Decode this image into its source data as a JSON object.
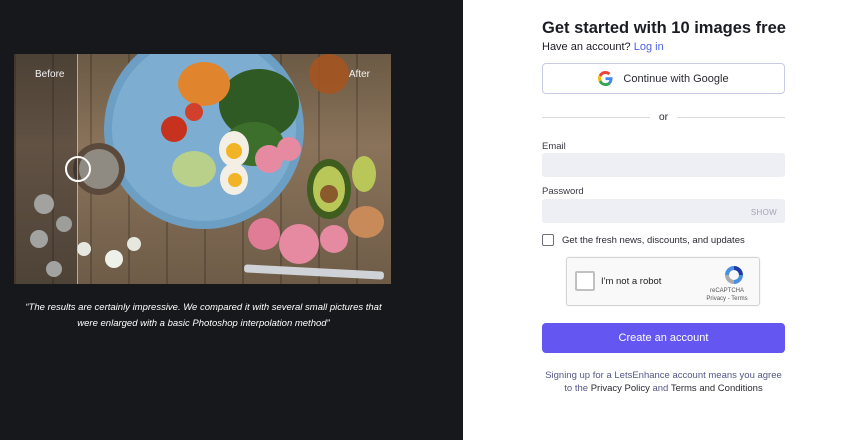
{
  "left": {
    "before_label": "Before",
    "after_label": "After",
    "testimonial": "“The results are certainly impressive. We compared it with several small pictures that were enlarged with a basic Photoshop interpolation method”"
  },
  "form": {
    "title": "Get started with 10 images free",
    "have_account": "Have an account?",
    "login_link": "Log in",
    "google_button": "Continue with Google",
    "or_text": "or",
    "email_label": "Email",
    "email_value": "",
    "password_label": "Password",
    "password_value": "",
    "show_label": "SHOW",
    "newsletter_label": "Get the fresh news, discounts, and updates",
    "captcha_label": "I'm not a robot",
    "captcha_brand": "reCAPTCHA",
    "captcha_links": "Privacy - Terms",
    "create_button": "Create an account",
    "terms_prefix": "Signing up for a LetsEnhance account means you agree to the",
    "privacy_link": "Privacy Policy",
    "terms_and": "and",
    "terms_link": "Terms and Conditions"
  },
  "colors": {
    "left_bg": "#17181c",
    "accent": "#6456f0",
    "link": "#4b63e0"
  }
}
